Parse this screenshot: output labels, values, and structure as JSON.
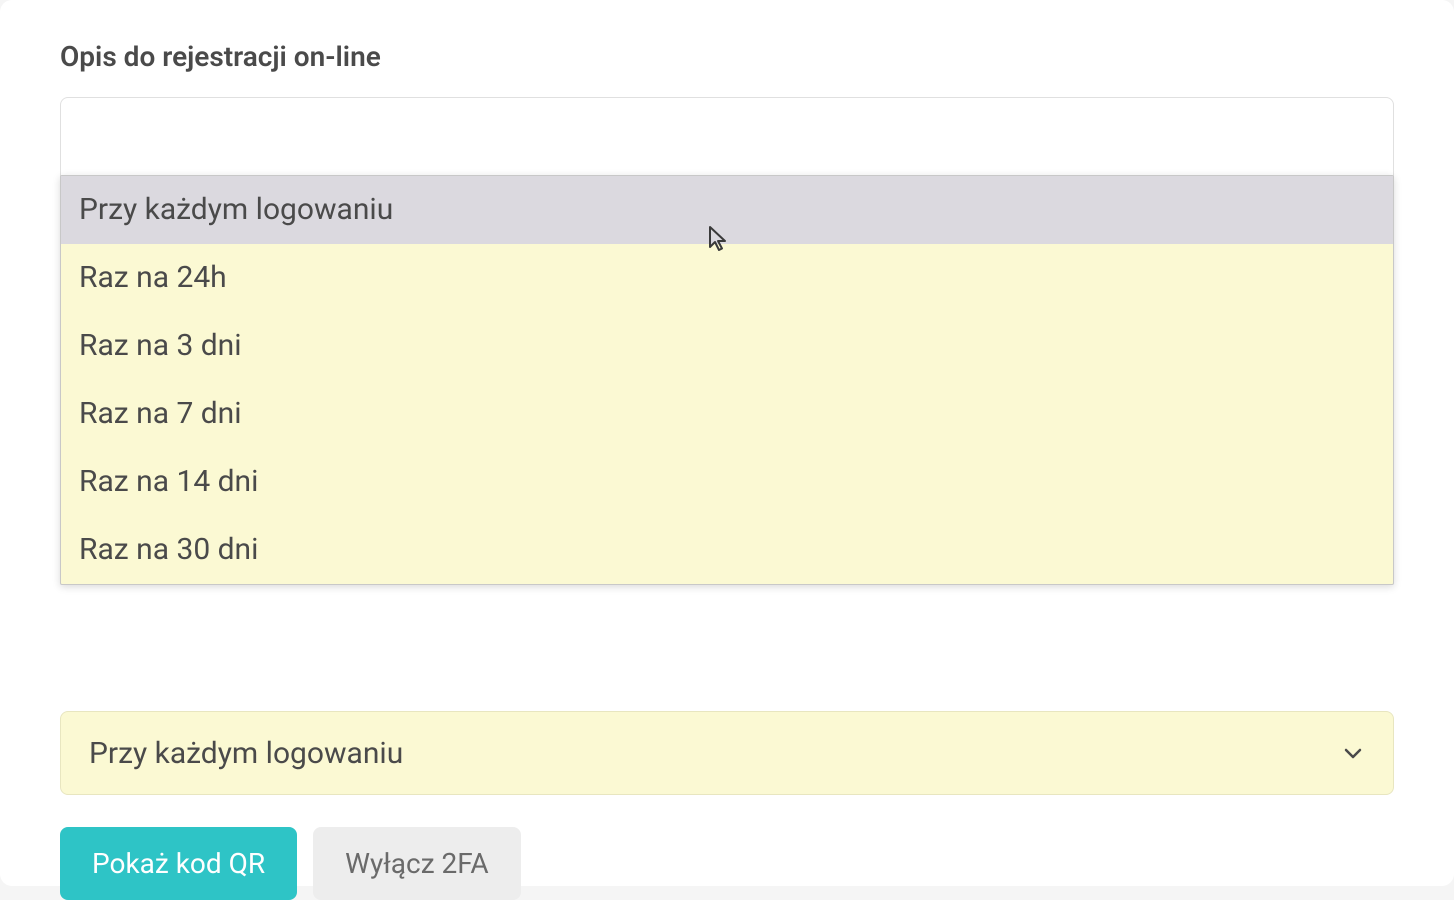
{
  "section": {
    "title": "Opis do rejestracji on-line"
  },
  "description_value": "",
  "dropdown": {
    "options": [
      "Przy każdym logowaniu",
      "Raz na 24h",
      "Raz na 3 dni",
      "Raz na 7 dni",
      "Raz na 14 dni",
      "Raz na 30 dni"
    ],
    "selected": "Przy każdym logowaniu",
    "highlighted_index": 0
  },
  "buttons": {
    "show_qr": "Pokaż kod QR",
    "disable_2fa": "Wyłącz 2FA"
  }
}
